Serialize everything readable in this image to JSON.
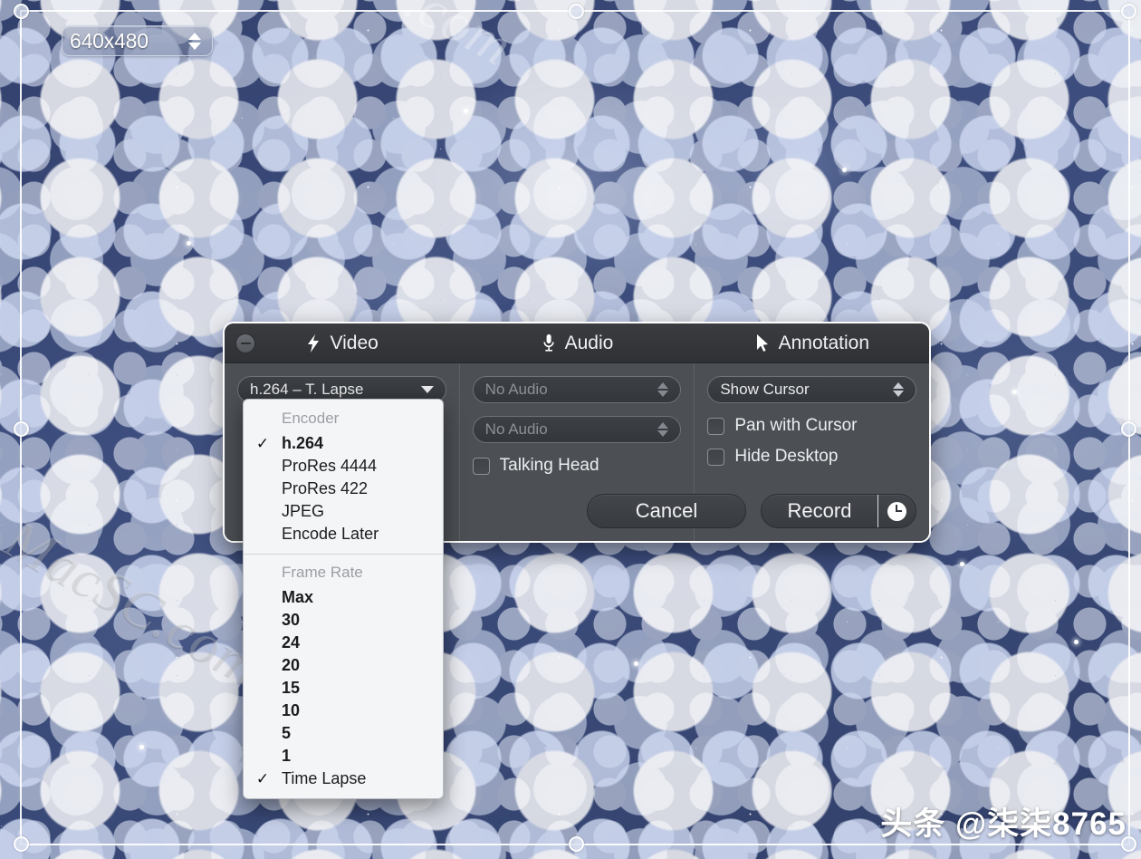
{
  "desktop": {
    "watermark_macsc": "MacSC.com",
    "watermark_top": ".com",
    "watermark_toutiao": "头条 @柒柒8765",
    "background_color": "#3b4a77"
  },
  "selection": {
    "name": "capture-selection-rectangle",
    "handle_count": 8
  },
  "resolution_stepper": {
    "value": "640x480",
    "up_icon": "triangle-up-icon",
    "down_icon": "triangle-down-icon"
  },
  "hud": {
    "collapse_icon": "minus-circle-icon",
    "tabs": [
      {
        "label": "Video",
        "icon": "lightning-bolt-icon"
      },
      {
        "label": "Audio",
        "icon": "microphone-icon"
      },
      {
        "label": "Annotation",
        "icon": "cursor-arrow-icon"
      }
    ],
    "video": {
      "encoder_select_value": "h.264 – T. Lapse"
    },
    "audio": {
      "input1_value": "No Audio",
      "input2_value": "No Audio",
      "talking_head_label": "Talking Head",
      "talking_head_checked": false
    },
    "annotation": {
      "cursor_select_value": "Show Cursor",
      "pan_with_cursor_label": "Pan with Cursor",
      "pan_with_cursor_checked": false,
      "hide_desktop_label": "Hide Desktop",
      "hide_desktop_checked": false
    },
    "actions": {
      "cancel_label": "Cancel",
      "record_label": "Record",
      "record_timer_icon": "clock-icon"
    }
  },
  "encoder_menu": {
    "sections": [
      {
        "header": "Encoder",
        "items": [
          {
            "label": "h.264",
            "checked": true,
            "bold": true
          },
          {
            "label": "ProRes 4444",
            "checked": false,
            "bold": false
          },
          {
            "label": "ProRes 422",
            "checked": false,
            "bold": false
          },
          {
            "label": "JPEG",
            "checked": false,
            "bold": false
          },
          {
            "label": "Encode Later",
            "checked": false,
            "bold": false
          }
        ]
      },
      {
        "header": "Frame Rate",
        "items": [
          {
            "label": "Max",
            "checked": false,
            "bold": true
          },
          {
            "label": "30",
            "checked": false,
            "bold": true
          },
          {
            "label": "24",
            "checked": false,
            "bold": true
          },
          {
            "label": "20",
            "checked": false,
            "bold": true
          },
          {
            "label": "15",
            "checked": false,
            "bold": true
          },
          {
            "label": "10",
            "checked": false,
            "bold": true
          },
          {
            "label": "5",
            "checked": false,
            "bold": true
          },
          {
            "label": "1",
            "checked": false,
            "bold": true
          },
          {
            "label": "Time Lapse",
            "checked": true,
            "bold": false
          }
        ]
      }
    ],
    "check_glyph": "✓"
  }
}
